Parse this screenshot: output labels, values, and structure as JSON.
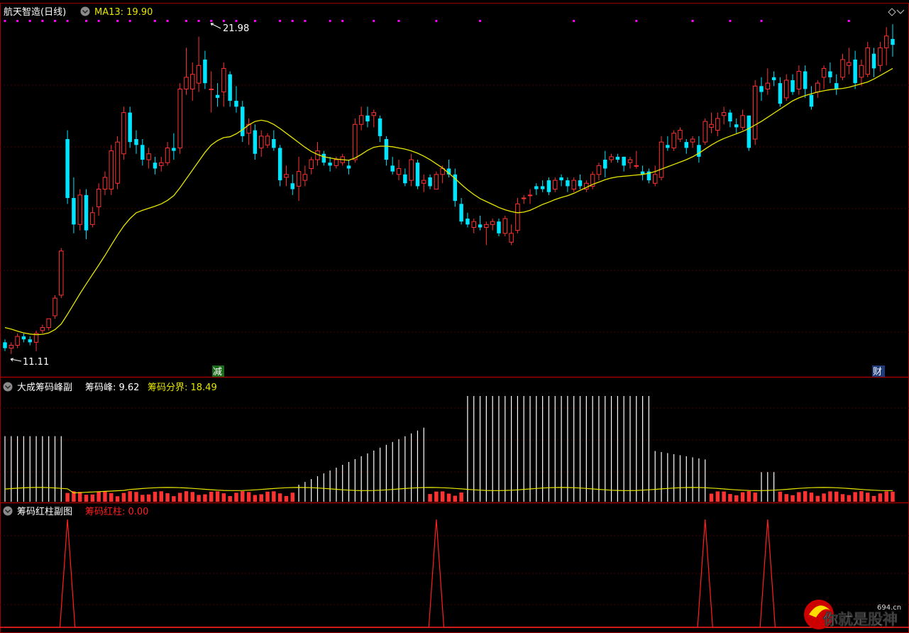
{
  "main": {
    "stock_name": "航天智造(日线)",
    "ma_label": "MA13: 19.90",
    "high_label": "21.98",
    "low_label": "11.11",
    "marker_left": "减",
    "marker_right": "财"
  },
  "sub1": {
    "name": "大成筹码峰副",
    "peak_label": "筹码峰: 9.62",
    "divide_label": "筹码分界: 18.49"
  },
  "sub2": {
    "name": "筹码红柱副图",
    "red_label": "筹码红柱: 0.00"
  },
  "watermark": {
    "text": "你就是股神",
    "site": "694.cn"
  },
  "colors": {
    "up": "#ff3232",
    "down": "#00e5ff",
    "ma": "#e6e600",
    "grid": "#5a0000",
    "border": "#a00000",
    "white": "#ffffff",
    "magenta": "#ff00ff"
  },
  "chart_data": [
    {
      "type": "candlestick",
      "title": "航天智造(日线)",
      "ylim": [
        10.5,
        22.5
      ],
      "ohlc": [
        [
          11.6,
          11.7,
          11.3,
          11.4
        ],
        [
          11.4,
          11.6,
          11.2,
          11.5
        ],
        [
          11.5,
          11.9,
          11.4,
          11.8
        ],
        [
          11.8,
          11.9,
          11.6,
          11.7
        ],
        [
          11.7,
          11.8,
          11.5,
          11.6
        ],
        [
          11.6,
          12.0,
          11.3,
          11.9
        ],
        [
          12.0,
          12.2,
          11.9,
          12.1
        ],
        [
          12.1,
          12.4,
          12.0,
          12.4
        ],
        [
          12.5,
          13.2,
          12.4,
          13.1
        ],
        [
          13.2,
          14.8,
          13.1,
          14.7
        ],
        [
          18.5,
          18.8,
          16.3,
          16.5
        ],
        [
          16.5,
          17.2,
          15.3,
          15.6
        ],
        [
          15.6,
          16.8,
          15.4,
          16.6
        ],
        [
          16.6,
          16.8,
          15.1,
          15.4
        ],
        [
          15.6,
          16.2,
          15.5,
          16.0
        ],
        [
          16.2,
          17.0,
          15.9,
          16.8
        ],
        [
          16.8,
          17.4,
          16.6,
          17.2
        ],
        [
          16.8,
          18.3,
          16.6,
          18.1
        ],
        [
          17.0,
          18.6,
          16.8,
          18.4
        ],
        [
          18.0,
          19.6,
          17.8,
          19.4
        ],
        [
          19.4,
          19.6,
          18.2,
          18.4
        ],
        [
          18.5,
          18.8,
          18.0,
          18.3
        ],
        [
          18.3,
          18.5,
          17.6,
          17.8
        ],
        [
          17.8,
          18.2,
          17.5,
          18.0
        ],
        [
          17.7,
          17.9,
          17.3,
          17.5
        ],
        [
          17.6,
          17.9,
          17.4,
          17.7
        ],
        [
          17.7,
          18.4,
          17.6,
          18.2
        ],
        [
          18.2,
          18.7,
          17.8,
          18.1
        ],
        [
          18.2,
          20.4,
          18.0,
          20.2
        ],
        [
          20.2,
          21.6,
          20.0,
          20.6
        ],
        [
          20.2,
          21.1,
          19.8,
          20.7
        ],
        [
          20.4,
          21.98,
          20.1,
          21.0
        ],
        [
          21.2,
          21.5,
          20.2,
          20.4
        ],
        [
          20.2,
          20.8,
          19.4,
          20.2
        ],
        [
          20.0,
          20.4,
          19.6,
          19.9
        ],
        [
          20.1,
          21.1,
          19.6,
          20.9
        ],
        [
          20.7,
          20.8,
          19.6,
          19.8
        ],
        [
          19.8,
          20.3,
          19.4,
          19.6
        ],
        [
          19.6,
          19.8,
          18.4,
          18.6
        ],
        [
          18.7,
          19.2,
          18.3,
          19.0
        ],
        [
          18.8,
          19.0,
          17.8,
          18.0
        ],
        [
          18.2,
          18.8,
          17.9,
          18.6
        ],
        [
          18.3,
          18.7,
          18.2,
          18.6
        ],
        [
          18.5,
          18.8,
          18.1,
          18.2
        ],
        [
          18.2,
          18.3,
          16.9,
          17.1
        ],
        [
          17.2,
          17.6,
          16.9,
          17.3
        ],
        [
          17.0,
          17.3,
          16.6,
          16.8
        ],
        [
          16.9,
          17.9,
          16.4,
          17.4
        ],
        [
          17.1,
          17.6,
          16.9,
          17.3
        ],
        [
          17.5,
          17.9,
          17.3,
          17.8
        ],
        [
          17.8,
          18.4,
          17.6,
          18.1
        ],
        [
          18.0,
          18.1,
          17.6,
          17.7
        ],
        [
          17.7,
          17.9,
          17.4,
          17.6
        ],
        [
          17.6,
          17.9,
          17.5,
          17.8
        ],
        [
          17.7,
          18.0,
          17.6,
          17.9
        ],
        [
          17.6,
          17.8,
          17.3,
          17.5
        ],
        [
          17.8,
          19.2,
          17.7,
          19.0
        ],
        [
          19.0,
          19.6,
          18.8,
          19.3
        ],
        [
          19.3,
          19.6,
          18.9,
          19.1
        ],
        [
          19.3,
          19.5,
          18.9,
          19.4
        ],
        [
          19.2,
          19.3,
          18.4,
          18.6
        ],
        [
          18.5,
          18.6,
          17.6,
          17.8
        ],
        [
          17.6,
          17.9,
          17.3,
          17.4
        ],
        [
          17.3,
          17.8,
          17.1,
          17.5
        ],
        [
          17.3,
          17.5,
          16.9,
          17.0
        ],
        [
          17.1,
          18.0,
          16.9,
          17.8
        ],
        [
          17.7,
          17.8,
          16.8,
          16.9
        ],
        [
          17.0,
          17.3,
          16.7,
          17.1
        ],
        [
          17.2,
          17.3,
          16.8,
          16.9
        ],
        [
          16.8,
          17.4,
          16.8,
          17.3
        ],
        [
          17.3,
          17.6,
          17.0,
          17.5
        ],
        [
          17.5,
          17.8,
          17.2,
          17.3
        ],
        [
          17.3,
          17.5,
          16.2,
          16.4
        ],
        [
          16.3,
          16.5,
          15.6,
          15.7
        ],
        [
          15.8,
          16.0,
          15.5,
          15.6
        ],
        [
          15.5,
          15.8,
          15.3,
          15.7
        ],
        [
          15.6,
          15.9,
          15.4,
          15.5
        ],
        [
          15.5,
          15.7,
          14.9,
          15.6
        ],
        [
          15.6,
          15.8,
          15.4,
          15.7
        ],
        [
          15.7,
          15.8,
          15.2,
          15.3
        ],
        [
          15.3,
          15.9,
          15.2,
          15.8
        ],
        [
          15.0,
          15.6,
          14.9,
          15.3
        ],
        [
          15.4,
          16.5,
          15.3,
          16.3
        ],
        [
          16.5,
          16.6,
          16.3,
          16.5
        ],
        [
          16.6,
          16.8,
          16.3,
          16.6
        ],
        [
          16.9,
          17.0,
          16.6,
          16.8
        ],
        [
          16.9,
          17.1,
          16.7,
          16.8
        ],
        [
          17.1,
          17.2,
          16.6,
          16.7
        ],
        [
          16.8,
          17.2,
          16.7,
          17.1
        ],
        [
          17.2,
          17.3,
          16.9,
          17.1
        ],
        [
          17.1,
          17.2,
          16.7,
          16.9
        ],
        [
          16.8,
          17.2,
          16.7,
          17.1
        ],
        [
          17.1,
          17.3,
          16.8,
          16.9
        ],
        [
          16.8,
          17.1,
          16.7,
          17.0
        ],
        [
          16.9,
          17.4,
          16.8,
          17.3
        ],
        [
          17.3,
          17.7,
          17.1,
          17.6
        ],
        [
          17.8,
          18.1,
          17.2,
          17.5
        ],
        [
          17.8,
          18.0,
          17.7,
          17.9
        ],
        [
          17.9,
          18.0,
          17.7,
          17.8
        ],
        [
          17.9,
          17.9,
          17.4,
          17.6
        ],
        [
          17.7,
          17.9,
          17.5,
          17.8
        ],
        [
          17.6,
          18.1,
          17.5,
          17.6
        ],
        [
          17.4,
          17.6,
          17.1,
          17.3
        ],
        [
          17.4,
          17.5,
          17.0,
          17.1
        ],
        [
          17.0,
          17.6,
          16.9,
          17.3
        ],
        [
          17.2,
          18.6,
          17.1,
          18.4
        ],
        [
          18.3,
          18.6,
          18.1,
          18.2
        ],
        [
          18.2,
          18.8,
          18.1,
          18.7
        ],
        [
          18.5,
          18.9,
          18.4,
          18.8
        ],
        [
          18.4,
          18.5,
          18.0,
          18.2
        ],
        [
          18.4,
          18.6,
          18.2,
          18.5
        ],
        [
          18.3,
          18.6,
          17.7,
          17.9
        ],
        [
          18.4,
          19.2,
          18.3,
          19.1
        ],
        [
          18.9,
          19.4,
          18.7,
          19.0
        ],
        [
          18.8,
          19.4,
          18.6,
          19.2
        ],
        [
          19.3,
          19.6,
          19.0,
          19.4
        ],
        [
          19.4,
          19.5,
          18.9,
          19.1
        ],
        [
          19.0,
          19.2,
          18.7,
          18.9
        ],
        [
          18.9,
          19.5,
          18.8,
          19.3
        ],
        [
          19.3,
          19.3,
          18.1,
          18.2
        ],
        [
          18.5,
          20.5,
          18.3,
          20.3
        ],
        [
          20.3,
          20.6,
          19.8,
          20.1
        ],
        [
          20.2,
          20.9,
          20.0,
          20.4
        ],
        [
          20.6,
          20.8,
          20.3,
          20.5
        ],
        [
          20.4,
          20.6,
          19.6,
          19.7
        ],
        [
          19.9,
          20.7,
          19.8,
          20.5
        ],
        [
          20.5,
          20.7,
          20.0,
          20.1
        ],
        [
          20.2,
          21.0,
          20.0,
          20.8
        ],
        [
          20.8,
          21.0,
          19.9,
          20.2
        ],
        [
          20.0,
          20.3,
          19.5,
          19.6
        ],
        [
          20.1,
          20.5,
          19.9,
          20.4
        ],
        [
          20.6,
          21.0,
          20.2,
          20.9
        ],
        [
          20.8,
          21.1,
          20.4,
          20.6
        ],
        [
          20.4,
          20.7,
          20.0,
          20.2
        ],
        [
          20.6,
          21.4,
          20.5,
          21.2
        ],
        [
          21.0,
          21.6,
          20.7,
          21.1
        ],
        [
          21.2,
          21.5,
          20.2,
          20.4
        ],
        [
          20.6,
          21.2,
          20.3,
          21.0
        ],
        [
          20.7,
          21.8,
          20.6,
          21.6
        ],
        [
          21.4,
          21.6,
          20.6,
          20.9
        ],
        [
          21.0,
          21.8,
          20.8,
          21.6
        ],
        [
          21.6,
          22.3,
          21.0,
          22.0
        ],
        [
          21.9,
          22.4,
          21.3,
          21.7
        ]
      ],
      "ma13": [
        12.1,
        12.05,
        11.98,
        11.92,
        11.88,
        11.86,
        11.87,
        11.92,
        12.03,
        12.22,
        12.55,
        12.9,
        13.25,
        13.58,
        13.9,
        14.22,
        14.55,
        14.9,
        15.24,
        15.55,
        15.8,
        16.0,
        16.08,
        16.15,
        16.22,
        16.3,
        16.42,
        16.58,
        16.85,
        17.15,
        17.45,
        17.75,
        18.05,
        18.3,
        18.45,
        18.55,
        18.58,
        18.68,
        18.82,
        18.98,
        19.1,
        19.14,
        19.1,
        19.0,
        18.86,
        18.7,
        18.54,
        18.38,
        18.22,
        18.08,
        17.98,
        17.9,
        17.86,
        17.82,
        17.8,
        17.78,
        17.86,
        17.98,
        18.12,
        18.22,
        18.26,
        18.26,
        18.24,
        18.2,
        18.16,
        18.1,
        18.02,
        17.92,
        17.8,
        17.66,
        17.52,
        17.34,
        17.16,
        16.96,
        16.78,
        16.62,
        16.48,
        16.38,
        16.28,
        16.18,
        16.1,
        16.04,
        16.0,
        16.02,
        16.08,
        16.18,
        16.28,
        16.36,
        16.45,
        16.52,
        16.58,
        16.66,
        16.76,
        16.86,
        16.96,
        17.04,
        17.12,
        17.18,
        17.22,
        17.24,
        17.26,
        17.28,
        17.3,
        17.34,
        17.4,
        17.48,
        17.56,
        17.64,
        17.72,
        17.8,
        17.9,
        18.02,
        18.16,
        18.3,
        18.42,
        18.52,
        18.6,
        18.68,
        18.76,
        18.86,
        18.98,
        19.1,
        19.24,
        19.38,
        19.52,
        19.66,
        19.8,
        19.9,
        19.98,
        20.04,
        20.1,
        20.14,
        20.18,
        20.2,
        20.22,
        20.26,
        20.32,
        20.38,
        20.44,
        20.54,
        20.66,
        20.78,
        20.9
      ],
      "high": 21.98,
      "low": 11.11,
      "ma13_last": 19.9
    },
    {
      "type": "bar",
      "title": "大成筹码峰副",
      "series": [
        {
          "name": "筹码峰",
          "last": 9.62
        },
        {
          "name": "筹码分界",
          "last": 18.49
        }
      ],
      "white_bars": [
        {
          "from": 0,
          "to": 9,
          "level": 0.62
        },
        {
          "from": 47,
          "to": 67,
          "level_start": 0.16,
          "level_end": 0.7
        },
        {
          "from": 74,
          "to": 103,
          "level": 1.0
        },
        {
          "from": 104,
          "to": 112,
          "level_start": 0.48,
          "level_end": 0.4
        },
        {
          "from": 121,
          "to": 123,
          "level": 0.28
        }
      ],
      "red_bar_level": 0.1,
      "yellow_line_level": 0.12
    },
    {
      "type": "line",
      "title": "筹码红柱副图",
      "series": [
        {
          "name": "筹码红柱",
          "last": 0.0
        }
      ],
      "spike_indices": [
        10,
        69,
        112,
        122
      ]
    }
  ]
}
